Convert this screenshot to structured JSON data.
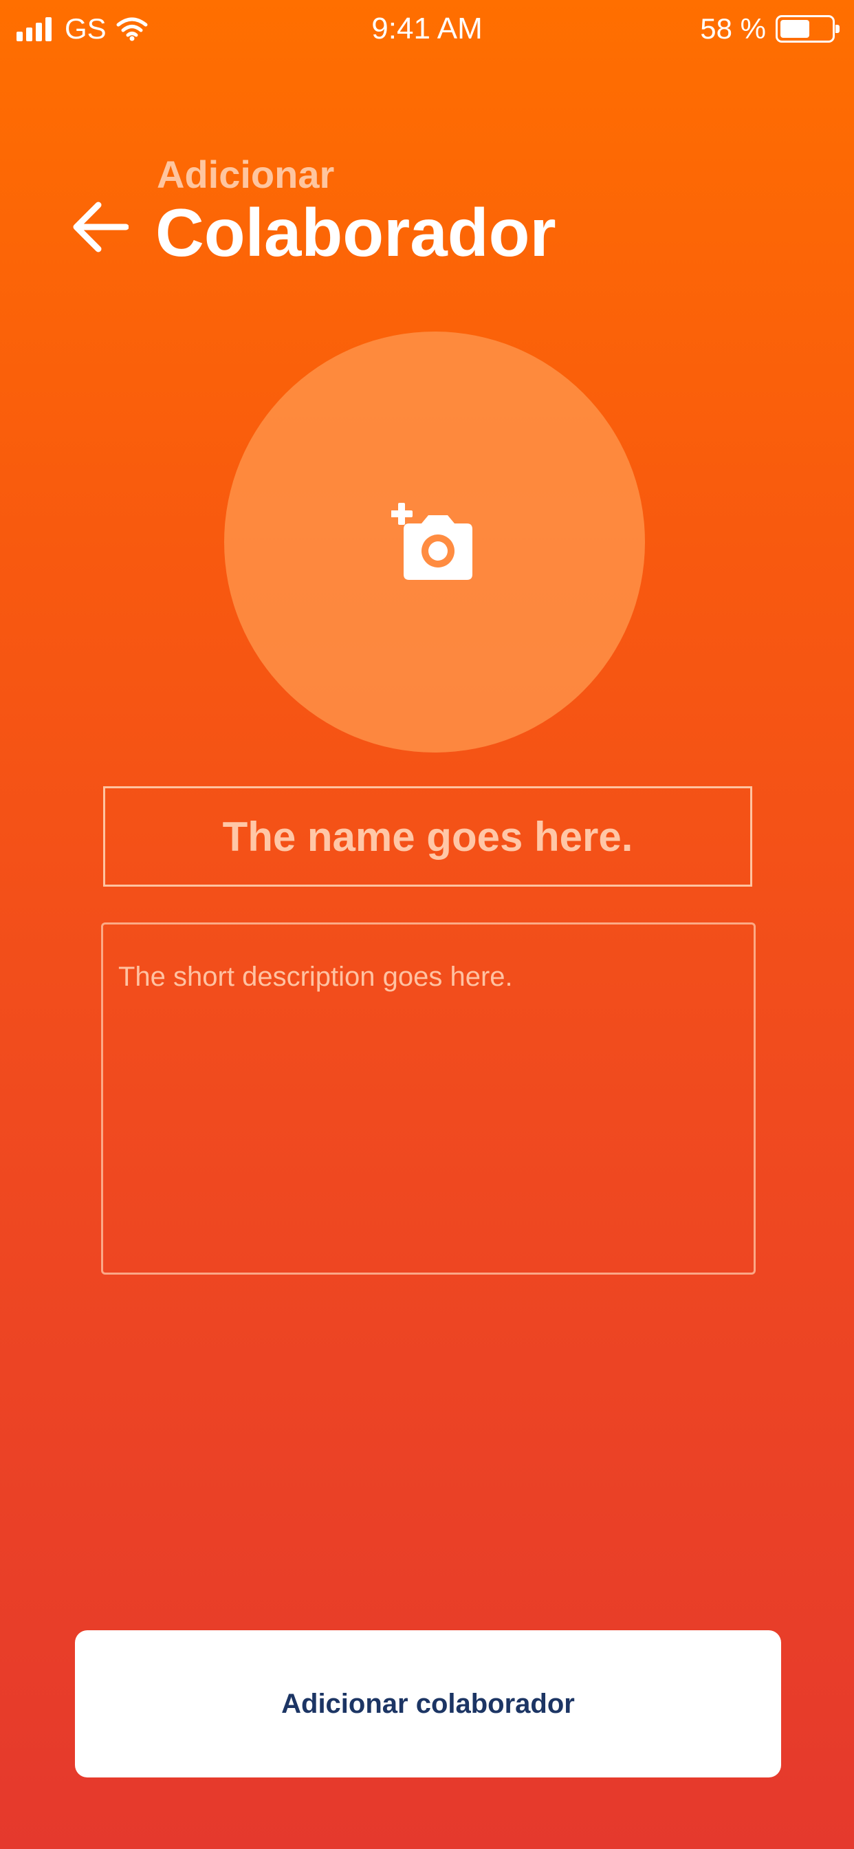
{
  "status_bar": {
    "carrier": "GS",
    "time": "9:41 AM",
    "battery": "58 %",
    "battery_level": 0.58,
    "signal_bars": 4
  },
  "header": {
    "subtitle": "Adicionar",
    "title": "Colaborador",
    "back_icon": "arrow-left-icon"
  },
  "avatar": {
    "icon": "add-photo-icon"
  },
  "form": {
    "name_placeholder": "The name goes here.",
    "name_value": "",
    "description_placeholder": "The short description goes here.",
    "description_value": ""
  },
  "actions": {
    "submit_label": "Adicionar colaborador"
  },
  "colors": {
    "gradient_top": "#FF6F00",
    "gradient_bottom": "#E5392D",
    "button_text": "#1C3564",
    "button_background": "#FFFFFF"
  }
}
